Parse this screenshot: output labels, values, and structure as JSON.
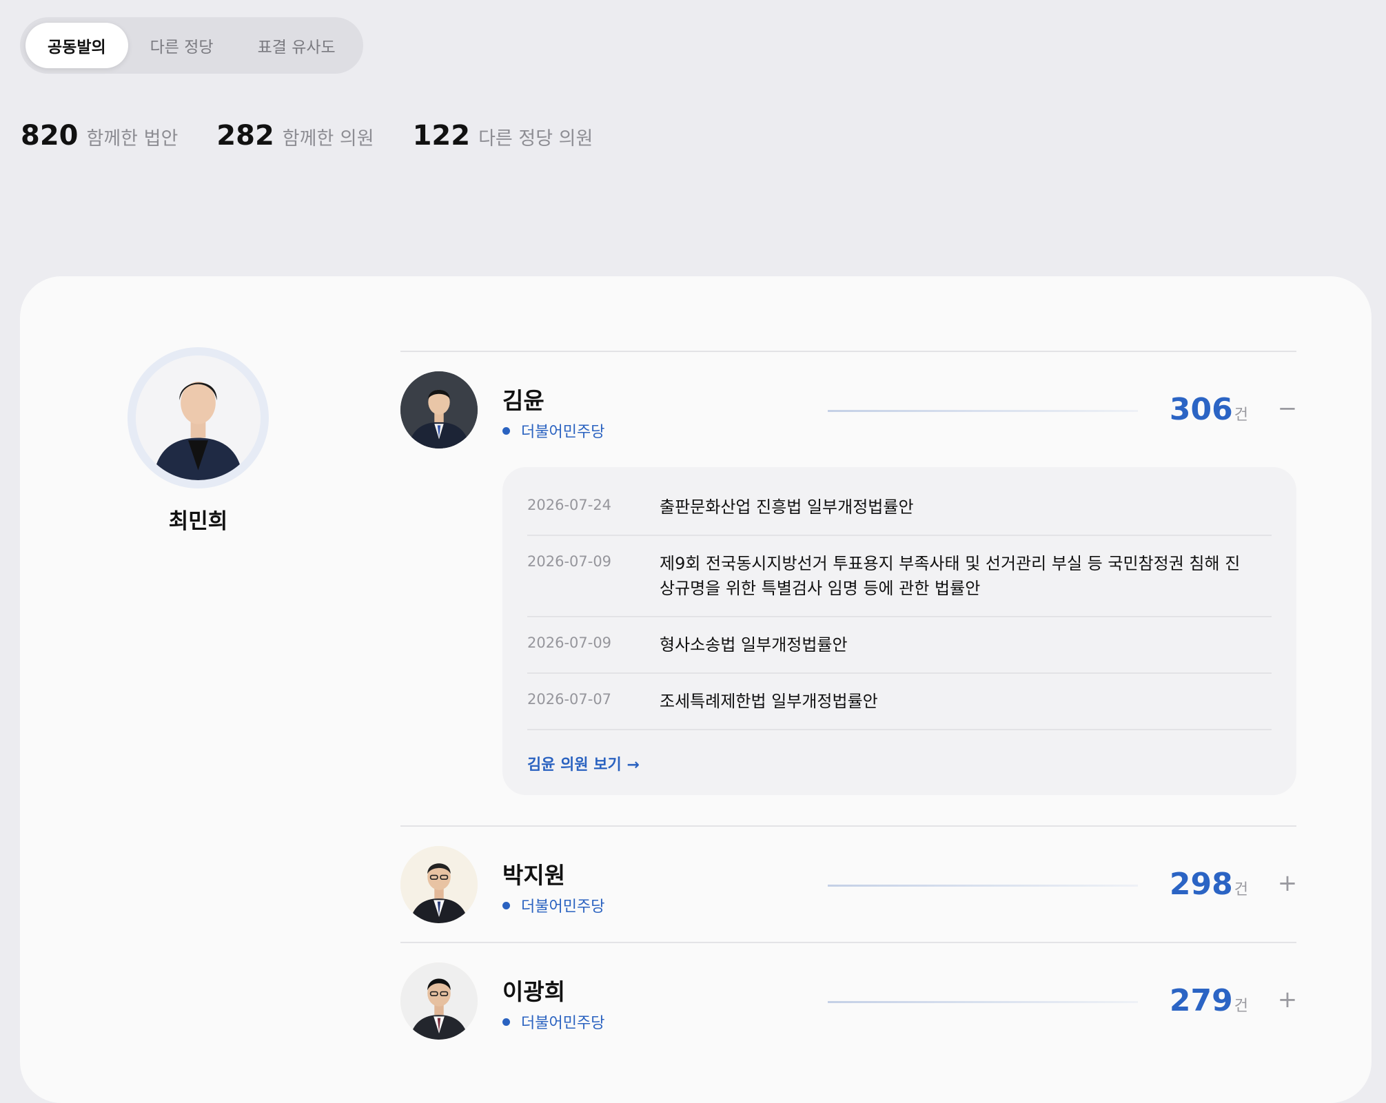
{
  "tabs": [
    {
      "label": "공동발의",
      "active": true
    },
    {
      "label": "다른 정당",
      "active": false
    },
    {
      "label": "표결 유사도",
      "active": false
    }
  ],
  "stats": [
    {
      "value": "820",
      "label": "함께한 법안"
    },
    {
      "value": "282",
      "label": "함께한 의원"
    },
    {
      "value": "122",
      "label": "다른 정당 의원"
    }
  ],
  "self": {
    "name": "최민희"
  },
  "members": [
    {
      "name": "김윤",
      "party": "더불어민주당",
      "count": "306",
      "unit": "건",
      "toggle": "−",
      "expanded": true,
      "bills": [
        {
          "date": "2026-07-24",
          "title": "출판문화산업 진흥법 일부개정법률안"
        },
        {
          "date": "2026-07-09",
          "title": "제9회 전국동시지방선거 투표용지 부족사태 및 선거관리 부실 등 국민참정권 침해 진상규명을 위한 특별검사 임명 등에 관한 법률안"
        },
        {
          "date": "2026-07-09",
          "title": "형사소송법 일부개정법률안"
        },
        {
          "date": "2026-07-07",
          "title": "조세특례제한법 일부개정법률안"
        }
      ],
      "link": "김윤 의원 보기 →"
    },
    {
      "name": "박지원",
      "party": "더불어민주당",
      "count": "298",
      "unit": "건",
      "toggle": "+",
      "expanded": false
    },
    {
      "name": "이광희",
      "party": "더불어민주당",
      "count": "279",
      "unit": "건",
      "toggle": "+",
      "expanded": false
    }
  ],
  "colors": {
    "accent": "#2b64c4",
    "party": "#2a62c0",
    "background": "#ececf0",
    "card": "#fafafa"
  }
}
